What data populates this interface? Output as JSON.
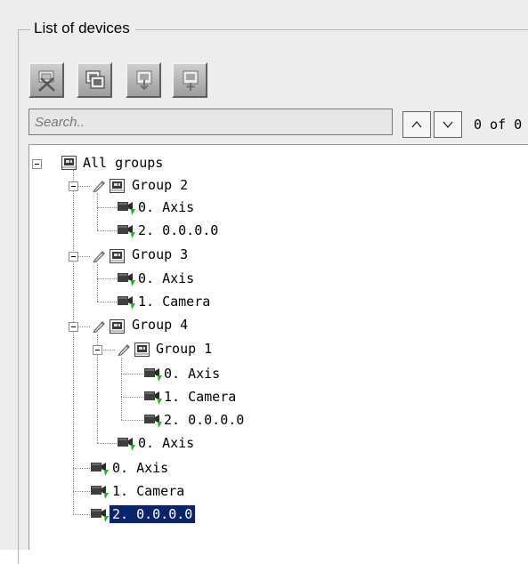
{
  "panel": {
    "title": "List of devices",
    "toolbar": [
      {
        "name": "disconnect-tool-button",
        "icon": "wrench-icon"
      },
      {
        "name": "copy-tool-button",
        "icon": "copy-icon"
      },
      {
        "name": "import-tool-button",
        "icon": "import-icon"
      },
      {
        "name": "add-tool-button",
        "icon": "add-icon"
      }
    ],
    "search": {
      "placeholder": "Search..",
      "value": ""
    },
    "counter": "0 of 0"
  },
  "tree": {
    "root": "All groups",
    "group2": {
      "label": "Group 2",
      "items": [
        "0. Axis",
        "2. 0.0.0.0"
      ]
    },
    "group3": {
      "label": "Group 3",
      "items": [
        "0. Axis",
        "1. Camera"
      ]
    },
    "group4": {
      "label": "Group 4",
      "group1": {
        "label": "Group 1",
        "items": [
          "0. Axis",
          "1. Camera",
          "2. 0.0.0.0"
        ]
      },
      "items": [
        "0. Axis"
      ]
    },
    "items": [
      "0. Axis",
      "1. Camera",
      "2. 0.0.0.0"
    ],
    "selected": "2. 0.0.0.0"
  },
  "colors": {
    "selection": "#0a246a",
    "indicator": "#1fb125"
  }
}
